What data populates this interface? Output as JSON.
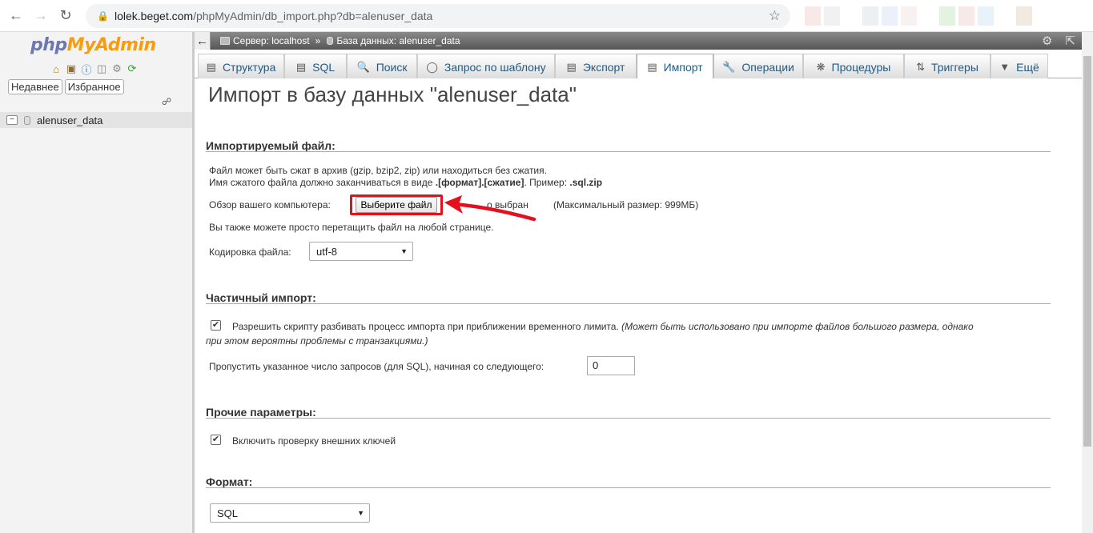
{
  "browser": {
    "url_host": "lolek.beget.com",
    "url_path": "/phpMyAdmin/db_import.php?db=alenuser_data"
  },
  "nav": {
    "logo_php": "php",
    "logo_my": "My",
    "logo_admin": "Admin",
    "tabs": [
      "Недавнее",
      "Избранное"
    ],
    "database": "alenuser_data"
  },
  "breadcrumb": {
    "server": "Сервер: localhost",
    "separator": "»",
    "database": "База данных: alenuser_data"
  },
  "tabs": [
    {
      "label": "Структура",
      "icon": "structure-icon"
    },
    {
      "label": "SQL",
      "icon": "sql-icon"
    },
    {
      "label": "Поиск",
      "icon": "search-icon"
    },
    {
      "label": "Запрос по шаблону",
      "icon": "query-icon"
    },
    {
      "label": "Экспорт",
      "icon": "export-icon"
    },
    {
      "label": "Импорт",
      "icon": "import-icon",
      "active": true
    },
    {
      "label": "Операции",
      "icon": "wrench-icon"
    },
    {
      "label": "Процедуры",
      "icon": "routines-icon"
    },
    {
      "label": "Триггеры",
      "icon": "triggers-icon"
    },
    {
      "label": "Ещё",
      "icon": "chevron-down-icon"
    }
  ],
  "page": {
    "title": "Импорт в базу данных \"alenuser_data\""
  },
  "import_file": {
    "legend": "Импортируемый файл:",
    "line1": "Файл может быть сжат в архив (gzip, bzip2, zip) или находиться без сжатия.",
    "line2_prefix": "Имя сжатого файла должно заканчиваться в виде ",
    "line2_format": ".[формат].[сжатие]",
    "line2_example_label": ". Пример: ",
    "line2_example": ".sql.zip",
    "browse_label": "Обзор вашего компьютера:",
    "choose_button": "Выберите файл",
    "no_file_fragment": "о выбран",
    "max_size": "(Максимальный размер: 999МБ)",
    "drag_hint": "Вы также можете просто перетащить файл на любой странице.",
    "charset_label": "Кодировка файла:",
    "charset_value": "utf-8"
  },
  "partial_import": {
    "legend": "Частичный импорт:",
    "allow_interrupt_label": "Разрешить скрипту разбивать процесс импорта при приближении временного лимита.",
    "allow_interrupt_note_1": "(Может быть использовано при импорте файлов большого размера, однако",
    "allow_interrupt_note_2": "при этом вероятны проблемы с транзакциями.)",
    "allow_interrupt_checked": true,
    "skip_label": "Пропустить указанное число запросов (для SQL), начиная со следующего:",
    "skip_value": "0"
  },
  "other_options": {
    "legend": "Прочие параметры:",
    "fk_checks_label": "Включить проверку внешних ключей",
    "fk_checks_checked": true
  },
  "format": {
    "legend": "Формат:",
    "value": "SQL"
  },
  "colors": {
    "highlight": "#e4101d",
    "tab_text": "#235a81"
  }
}
